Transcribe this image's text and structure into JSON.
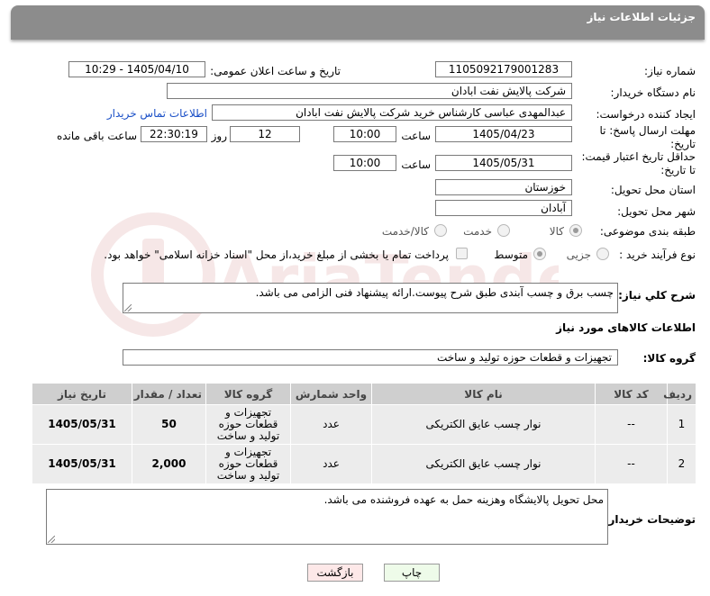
{
  "header": {
    "title": "جزئیات اطلاعات نیاز"
  },
  "fields": {
    "need_number_label": "شماره نیاز:",
    "need_number": "1105092179001283",
    "announce_label": "تاریخ و ساعت اعلان عمومی:",
    "announce_value": "1405/04/10 - 10:29",
    "buyer_org_label": "نام دستگاه خریدار:",
    "buyer_org": "شرکت پالایش نفت ابادان",
    "creator_label": "ایجاد کننده درخواست:",
    "creator": "عبدالمهدی  عباسی کارشناس خرید شرکت پالایش نفت ابادان",
    "contact_link": "اطلاعات تماس خریدار",
    "send_deadline_label_1": "مهلت ارسال پاسخ: تا",
    "send_deadline_label_2": "تاریخ:",
    "send_date": "1405/04/23",
    "time_label": "ساعت",
    "send_time": "10:00",
    "days_value": "12",
    "days_label": "روز و",
    "remaining_time": "22:30:19",
    "remaining_label": "ساعت باقی مانده",
    "validity_label_1": "حداقل تاریخ اعتبار قیمت:",
    "validity_label_2": "تا تاریخ:",
    "validity_date": "1405/05/31",
    "validity_time": "10:00",
    "province_label": "استان محل تحویل:",
    "province": "خوزستان",
    "city_label": "شهر محل تحویل:",
    "city": "آبادان",
    "category_label": "طبقه بندی موضوعی:",
    "category_options": [
      "کالا",
      "خدمت",
      "کالا/خدمت"
    ],
    "process_label": "نوع فرآیند خرید :",
    "process_options": [
      "جزیی",
      "متوسط"
    ],
    "payment_note": "پرداخت تمام یا بخشی از مبلغ خرید،از محل \"اسناد خزانه اسلامی\" خواهد بود."
  },
  "description": {
    "label": "شرح کلي نياز:",
    "text": "چسب برق و چسب آبندی طبق شرح پیوست.ارائه پیشنهاد فنی الزامی می باشد."
  },
  "goods_info": {
    "title": "اطلاعات کالاهای مورد نیاز",
    "group_label": "گروه کالا:",
    "group_value": "تجهیزات و قطعات حوزه تولید و ساخت"
  },
  "table": {
    "headers": [
      "ردیف",
      "کد کالا",
      "نام کالا",
      "واحد شمارش",
      "گروه کالا",
      "تعداد / مقدار",
      "تاریخ نیاز"
    ],
    "rows": [
      [
        "1",
        "--",
        "نوار چسب عایق الکتریکی",
        "عدد",
        "تجهیزات و قطعات حوزه تولید و ساخت",
        "50",
        "1405/05/31"
      ],
      [
        "2",
        "--",
        "نوار چسب عایق الکتریکی",
        "عدد",
        "تجهیزات و قطعات حوزه تولید و ساخت",
        "2,000",
        "1405/05/31"
      ]
    ]
  },
  "buyer_notes": {
    "label": "توضیحات خریدار:",
    "text": "محل تحویل پالایشگاه وهزینه حمل به عهده فروشنده می باشد."
  },
  "buttons": {
    "print": "چاپ",
    "back": "بازگشت"
  },
  "watermark": {
    "text": "AriaTender.neT"
  },
  "colors": {
    "header": "#8c8c8c",
    "link": "#1a4fc7",
    "table_header": "#cfcfcf",
    "table_cell": "#ececec"
  }
}
